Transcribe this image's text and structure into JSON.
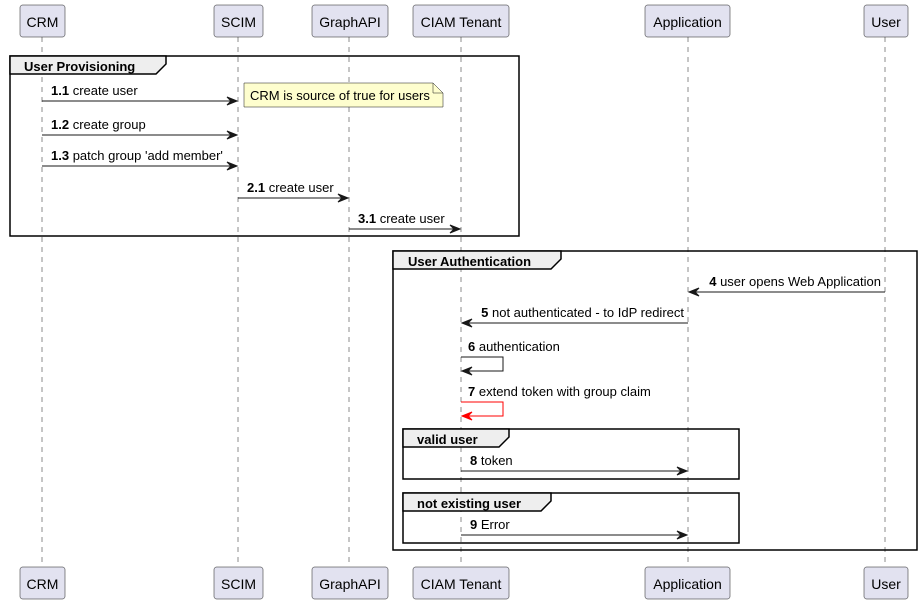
{
  "participants": [
    {
      "id": "crm",
      "label": "CRM"
    },
    {
      "id": "scim",
      "label": "SCIM"
    },
    {
      "id": "graphapi",
      "label": "GraphAPI"
    },
    {
      "id": "ciam",
      "label": "CIAM Tenant"
    },
    {
      "id": "app",
      "label": "Application"
    },
    {
      "id": "user",
      "label": "User"
    }
  ],
  "groups": [
    {
      "label": "User Provisioning"
    },
    {
      "label": "User Authentication"
    },
    {
      "label": "valid user"
    },
    {
      "label": "not existing user"
    }
  ],
  "note": {
    "text": "CRM is source of true for users",
    "color": "#fefece"
  },
  "messages": [
    {
      "num": "1.1",
      "text": "create user",
      "from": "CRM",
      "to": "SCIM",
      "color": "#181818"
    },
    {
      "num": "1.2",
      "text": "create group",
      "from": "CRM",
      "to": "SCIM",
      "color": "#181818"
    },
    {
      "num": "1.3",
      "text": "patch group 'add member'",
      "from": "CRM",
      "to": "SCIM",
      "color": "#181818"
    },
    {
      "num": "2.1",
      "text": "create user",
      "from": "SCIM",
      "to": "GraphAPI",
      "color": "#181818"
    },
    {
      "num": "3.1",
      "text": "create user",
      "from": "GraphAPI",
      "to": "CIAM Tenant",
      "color": "#181818"
    },
    {
      "num": "4",
      "text": "user opens Web Application",
      "from": "User",
      "to": "Application",
      "color": "#181818"
    },
    {
      "num": "5",
      "text": "not authenticated - to IdP redirect",
      "from": "Application",
      "to": "CIAM Tenant",
      "color": "#181818"
    },
    {
      "num": "6",
      "text": "authentication",
      "from": "CIAM Tenant",
      "to": "CIAM Tenant",
      "color": "#181818"
    },
    {
      "num": "7",
      "text": "extend token with group claim",
      "from": "CIAM Tenant",
      "to": "CIAM Tenant",
      "color": "#ff0000"
    },
    {
      "num": "8",
      "text": "token",
      "from": "CIAM Tenant",
      "to": "Application",
      "color": "#181818"
    },
    {
      "num": "9",
      "text": "Error",
      "from": "CIAM Tenant",
      "to": "Application",
      "color": "#181818"
    }
  ]
}
